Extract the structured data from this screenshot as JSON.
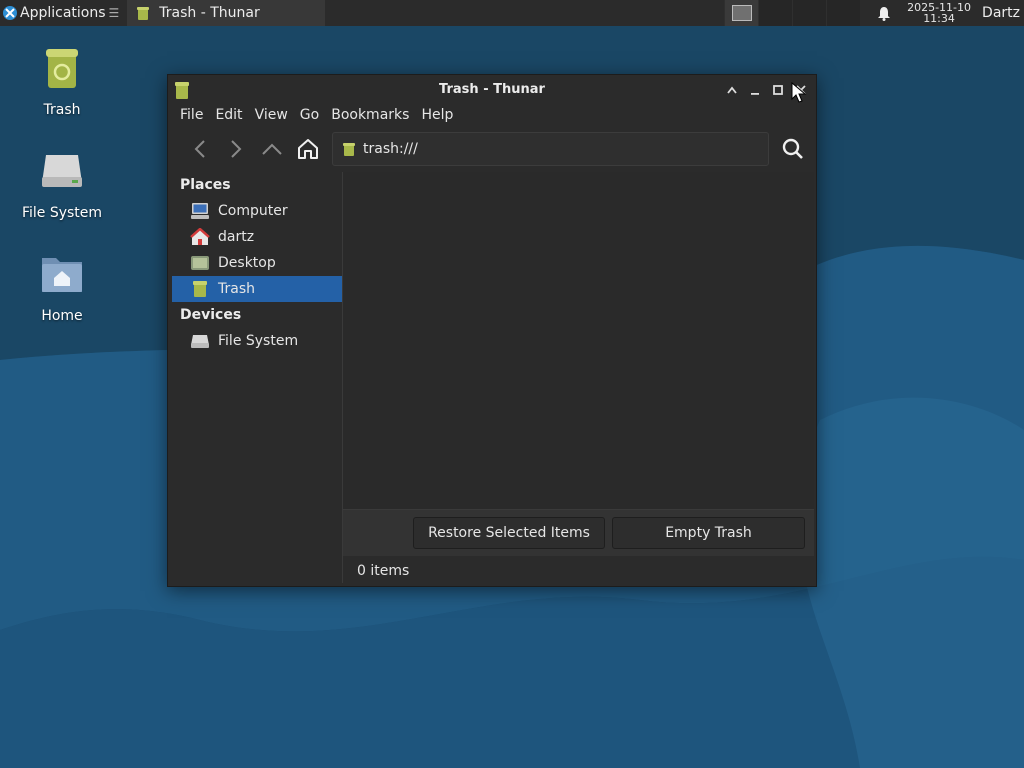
{
  "panel": {
    "apps_label": "Applications",
    "apps_sep": "☰",
    "task_label": "Trash - Thunar",
    "clock_date": "2025-11-10",
    "clock_time": "11:34",
    "user": "Dartz"
  },
  "desktop": {
    "icons": [
      {
        "label": "Trash",
        "icon": "trash-icon"
      },
      {
        "label": "File System",
        "icon": "drive-icon"
      },
      {
        "label": "Home",
        "icon": "home-folder-icon"
      }
    ]
  },
  "window": {
    "title": "Trash - Thunar",
    "menu": [
      "File",
      "Edit",
      "View",
      "Go",
      "Bookmarks",
      "Help"
    ],
    "location": "trash:///",
    "sidebar": {
      "places_header": "Places",
      "places": [
        {
          "label": "Computer",
          "icon": "computer-icon"
        },
        {
          "label": "dartz",
          "icon": "home-icon"
        },
        {
          "label": "Desktop",
          "icon": "desktop-icon"
        },
        {
          "label": "Trash",
          "icon": "trash-icon",
          "selected": true
        }
      ],
      "devices_header": "Devices",
      "devices": [
        {
          "label": "File System",
          "icon": "drive-icon"
        }
      ]
    },
    "restore_label": "Restore Selected Items",
    "empty_label": "Empty Trash",
    "status": "0 items"
  },
  "colors": {
    "selection": "#2461a7",
    "window_bg": "#2b2b2b",
    "wallpaper": "#1f5478"
  }
}
